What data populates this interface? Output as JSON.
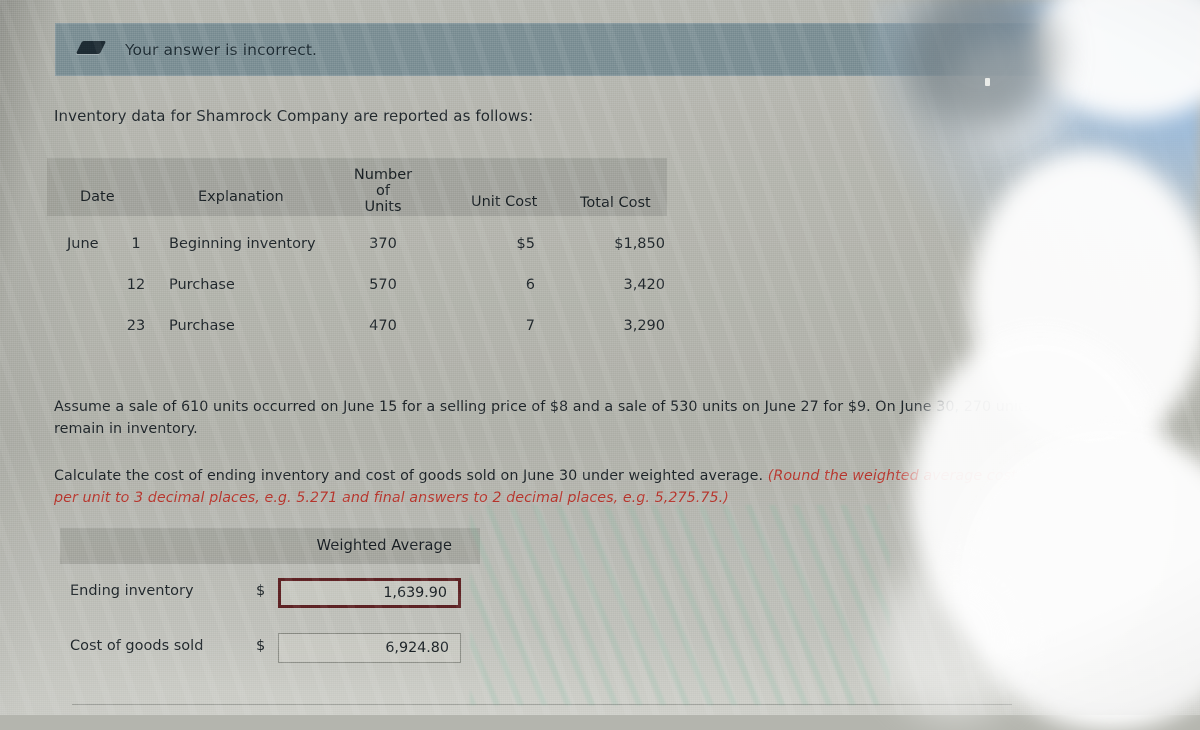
{
  "banner": {
    "icon": "incorrect-marker-icon",
    "message": "Your answer is incorrect.",
    "background_color": "#7c8f95"
  },
  "intro": {
    "text": "Inventory data for Shamrock Company are reported as follows:"
  },
  "inventory_table": {
    "headers": {
      "date": "Date",
      "explanation": "Explanation",
      "number_of_units_line1": "Number of",
      "number_of_units_line2": "Units",
      "unit_cost": "Unit Cost",
      "total_cost": "Total Cost"
    },
    "rows": [
      {
        "month": "June",
        "day": "1",
        "explanation": "Beginning inventory",
        "units": "370",
        "unit_cost": "$5",
        "total_cost": "$1,850"
      },
      {
        "month": "",
        "day": "12",
        "explanation": "Purchase",
        "units": "570",
        "unit_cost": "6",
        "total_cost": "3,420"
      },
      {
        "month": "",
        "day": "23",
        "explanation": "Purchase",
        "units": "470",
        "unit_cost": "7",
        "total_cost": "3,290"
      }
    ]
  },
  "problem": {
    "paragraph1": "Assume a sale of 610 units occurred on June 15 for a selling price of $8 and a sale of 530 units on June 27 for $9. On June 30, 270 units remain in inventory.",
    "paragraph2_plain": "Calculate the cost of ending inventory and cost of goods sold on June 30 under weighted average. ",
    "paragraph2_italic": "(Round the weighted average cost per unit to 3 decimal places, e.g. 5.271 and final answers to 2 decimal places, e.g. 5,275.75.)",
    "italic_color": "#b4352c"
  },
  "answers": {
    "column_header": "Weighted Average",
    "rows": [
      {
        "label": "Ending inventory",
        "currency_symbol": "$",
        "value": "1,639.90",
        "state": "incorrect",
        "border_color": "#5d2224"
      },
      {
        "label": "Cost of goods sold",
        "currency_symbol": "$",
        "value": "6,924.80",
        "state": "neutral",
        "border_color": "#8a8c85"
      }
    ]
  }
}
